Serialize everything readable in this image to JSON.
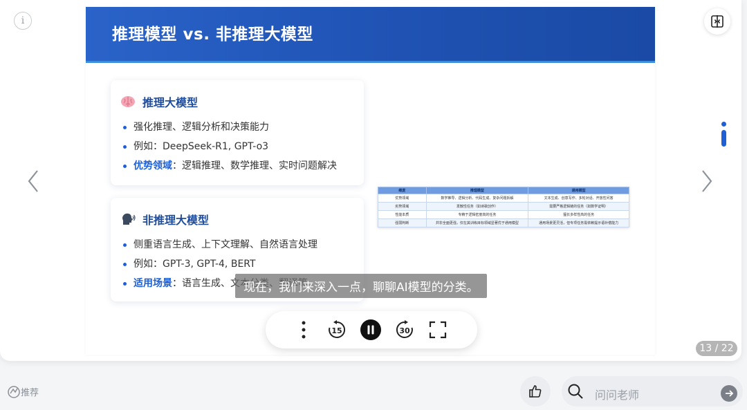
{
  "viewer": {
    "info_icon_glyph": "i",
    "page_counter": "13 / 22"
  },
  "slide": {
    "title": "推理模型 vs. 非推理大模型",
    "cards": [
      {
        "icon": "brain-icon",
        "title": "推理大模型",
        "bullets": [
          {
            "highlight": "",
            "text": "强化推理、逻辑分析和决策能力"
          },
          {
            "highlight": "",
            "text": "例如：DeepSeek-R1, GPT-o3"
          },
          {
            "highlight": "优势领域",
            "text": "：逻辑推理、数学推理、实时问题解决"
          }
        ]
      },
      {
        "icon": "speaking-head-icon",
        "title": "非推理大模型",
        "bullets": [
          {
            "highlight": "",
            "text": "侧重语言生成、上下文理解、自然语言处理"
          },
          {
            "highlight": "",
            "text": "例如：GPT-3, GPT-4, BERT"
          },
          {
            "highlight": "适用场景",
            "text": "：语言生成、文本分类、翻译等"
          }
        ]
      }
    ],
    "table": {
      "headers": [
        "维度",
        "推理模型",
        "通用模型"
      ],
      "rows": [
        [
          "优势领域",
          "数学推导、逻辑分析、代码生成、复杂问题拆解",
          "文本生成、创意写作、多轮对话、开放性问答"
        ],
        [
          "劣势领域",
          "发散性任务（如诗歌创作）",
          "需要严格逻辑链的任务（如数学证明）"
        ],
        [
          "性能本质",
          "专精于逻辑密度高的任务",
          "擅长多样性高的任务"
        ],
        [
          "强弱判断",
          "并非全面更强，仅在其训练目标领域显著优于通用模型",
          "通用场景更灵活，但专项任务需依赖提示语补偿能力"
        ]
      ]
    }
  },
  "subtitle": "现在，我们来深入一点，聊聊AI模型的分类。",
  "controls": {
    "more": "more-icon",
    "rewind": "15",
    "pause": "pause-icon",
    "forward": "30",
    "fullscreen": "fullscreen-icon"
  },
  "bottom": {
    "recommend_label": "推荐",
    "ask_placeholder": "问问老师"
  },
  "colors": {
    "accent": "#1f5fd6",
    "header_blue": "#2359bd",
    "card_title": "#1d4c9e"
  }
}
